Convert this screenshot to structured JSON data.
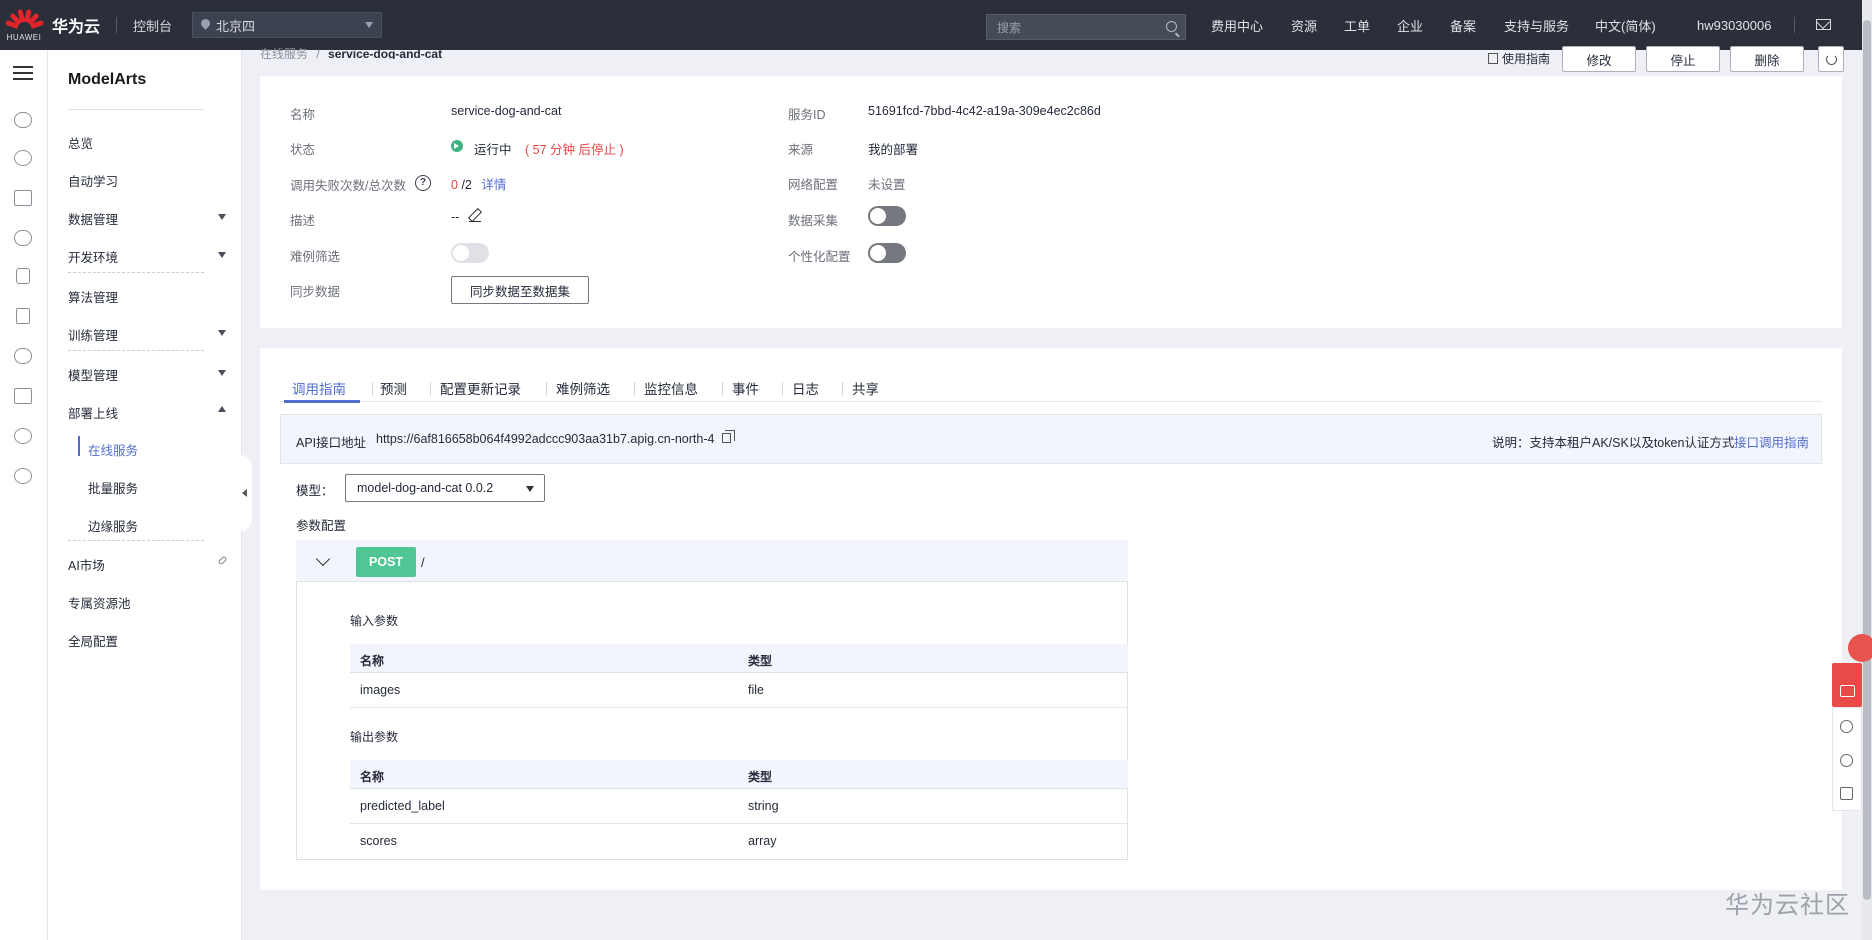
{
  "topbar": {
    "logo_sub": "HUAWEI",
    "brand": "华为云",
    "console": "控制台",
    "region": "北京四",
    "search_placeholder": "搜索",
    "nav": [
      "费用中心",
      "资源",
      "工单",
      "企业",
      "备案",
      "支持与服务",
      "中文(简体)",
      "hw93030006"
    ]
  },
  "sidebar": {
    "title": "ModelArts",
    "items": [
      "总览",
      "自动学习",
      "数据管理",
      "开发环境",
      "算法管理",
      "训练管理",
      "模型管理",
      "部署上线"
    ],
    "deploy_children": [
      "在线服务",
      "批量服务",
      "边缘服务"
    ],
    "bottom_items": [
      "AI市场",
      "专属资源池",
      "全局配置"
    ]
  },
  "breadcrumb": {
    "parent": "在线服务",
    "separator": "/",
    "current": "service-dog-and-cat"
  },
  "actions": {
    "guide": "使用指南",
    "modify": "修改",
    "stop": "停止",
    "delete": "删除"
  },
  "info": {
    "name_label": "名称",
    "name_value": "service-dog-and-cat",
    "status_label": "状态",
    "status_value": "运行中",
    "status_note": "( 57 分钟 后停止 )",
    "calls_label": "调用失败次数/总次数",
    "calls_fail": "0",
    "calls_total": "/2",
    "calls_detail": "详情",
    "desc_label": "描述",
    "desc_value": "--",
    "hard_label": "难例筛选",
    "sync_label": "同步数据",
    "sync_button": "同步数据至数据集",
    "service_id_label": "服务ID",
    "service_id_value": "51691fcd-7bbd-4c42-a19a-309e4ec2c86d",
    "source_label": "来源",
    "source_value": "我的部署",
    "network_label": "网络配置",
    "network_value": "未设置",
    "collect_label": "数据采集",
    "personal_label": "个性化配置"
  },
  "tabs": [
    "调用指南",
    "预测",
    "配置更新记录",
    "难例筛选",
    "监控信息",
    "事件",
    "日志",
    "共享"
  ],
  "api": {
    "label": "API接口地址",
    "url": "https://6af816658b064f4992adccc903aa31b7.apig.cn-north-4",
    "note": "说明：支持本租户AK/SK以及token认证方式",
    "guide_link": "接口调用指南"
  },
  "model": {
    "label": "模型：",
    "selected": "model-dog-and-cat 0.0.2"
  },
  "params": {
    "title": "参数配置",
    "method": "POST",
    "path": "/",
    "input_title": "输入参数",
    "output_title": "输出参数",
    "col_name": "名称",
    "col_type": "类型",
    "inputs": [
      {
        "name": "images",
        "type": "file"
      }
    ],
    "outputs": [
      {
        "name": "predicted_label",
        "type": "string"
      },
      {
        "name": "scores",
        "type": "array"
      }
    ]
  },
  "watermark": "华为云社区",
  "colors": {
    "topbar": "#2b2f3a",
    "accent": "#526ecc",
    "running": "#3fb27f",
    "danger": "#e54545",
    "post": "#50c694"
  }
}
